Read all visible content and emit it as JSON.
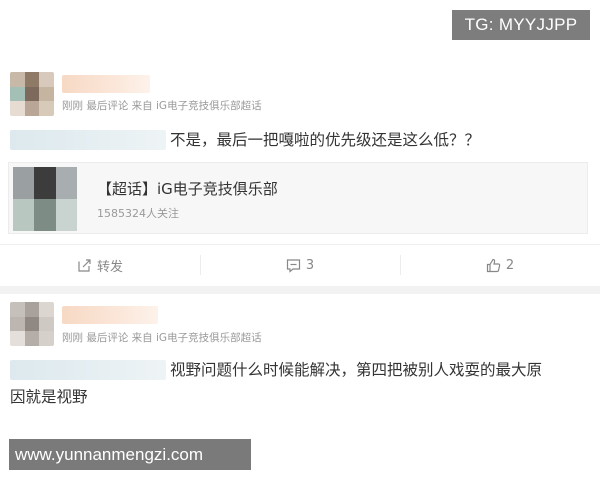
{
  "watermarks": {
    "top": "TG: MYYJJPP",
    "bottom": "www.yunnanmengzi.com"
  },
  "posts": [
    {
      "meta": "刚刚  最后评论  来自 iG电子竞技俱乐部超话",
      "text": "不是，最后一把嘎啦的优先级还是这么低？？",
      "card": {
        "title": "【超话】iG电子竞技俱乐部",
        "followers": "1585324人关注"
      },
      "actions": [
        {
          "icon": "share-icon",
          "label": "转发"
        },
        {
          "icon": "comment-icon",
          "label": "3"
        },
        {
          "icon": "like-icon",
          "label": "2"
        }
      ]
    },
    {
      "meta": "刚刚  最后评论  来自 iG电子竞技俱乐部超话",
      "text_line1": "视野问题什么时候能解决，第四把被别人戏耍的最大原",
      "text_line2": "因就是视野"
    }
  ],
  "colors": {
    "avatar1": [
      "#c8b8a8",
      "#8f7a68",
      "#d7c9bb",
      "#a4c0b6",
      "#7d6a5c",
      "#c5b49f",
      "#e6dcd2",
      "#b9a696",
      "#d8cab9"
    ],
    "avatar2": [
      "#c6c0bb",
      "#a9a29c",
      "#dcd6d1",
      "#bdb6b0",
      "#8f8883",
      "#cfc9c4",
      "#e4dfdb",
      "#b5aea8",
      "#d6d0cb"
    ],
    "thumb": [
      "#9aa0a2",
      "#3c3c3c",
      "#a8aeb0",
      "#b8c7c0",
      "#7d8d86",
      "#c9d3cf"
    ]
  }
}
